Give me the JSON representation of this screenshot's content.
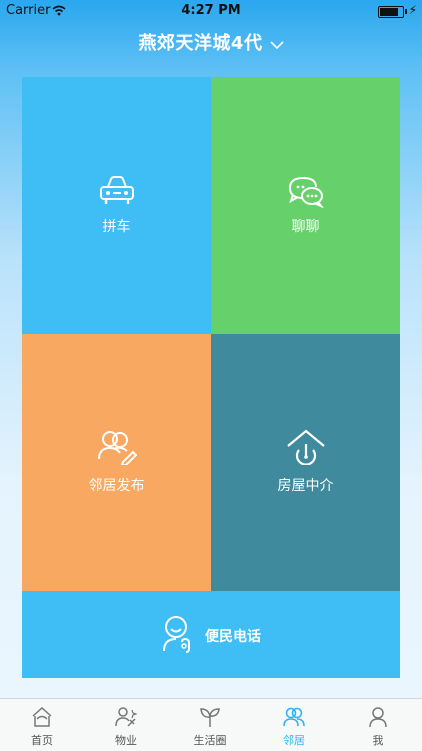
{
  "status_bar": {
    "carrier": "Carrier",
    "time": "4:27 PM",
    "battery_level": 0.9
  },
  "header": {
    "title": "燕郊天洋城4代"
  },
  "tiles": {
    "carpool": "拼车",
    "chat": "聊聊",
    "neighbor_post": "邻居发布",
    "real_estate": "房屋中介",
    "hotline": "便民电话"
  },
  "tabs": [
    {
      "label": "首页",
      "icon": "home-icon"
    },
    {
      "label": "物业",
      "icon": "property-icon"
    },
    {
      "label": "生活圈",
      "icon": "sprout-icon"
    },
    {
      "label": "邻居",
      "icon": "neighbors-icon",
      "active": true
    },
    {
      "label": "我",
      "icon": "profile-icon"
    }
  ],
  "colors": {
    "blue": "#3fbdf5",
    "green": "#66d06a",
    "orange": "#f8a860",
    "teal": "#408a9d",
    "accent": "#33b3ef"
  }
}
